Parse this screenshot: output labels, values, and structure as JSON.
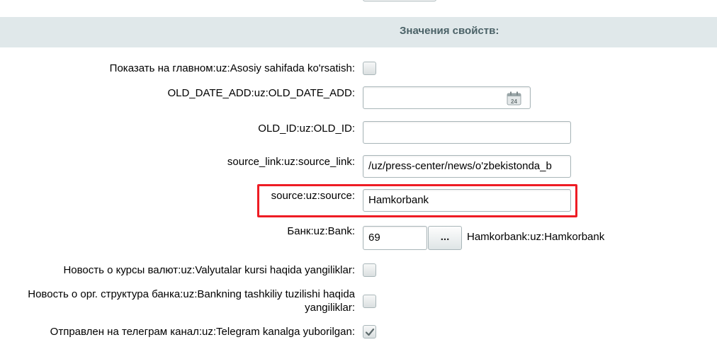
{
  "header": {
    "title": "Значения свойств:"
  },
  "fields": {
    "show_main": {
      "label": "Показать на главном:uz:Asosiy sahifada ko'rsatish:",
      "checked": false
    },
    "old_date_add": {
      "label": "OLD_DATE_ADD:uz:OLD_DATE_ADD:",
      "value": "",
      "icon": "calendar-icon",
      "calendar_day": "24"
    },
    "old_id": {
      "label": "OLD_ID:uz:OLD_ID:",
      "value": ""
    },
    "source_link": {
      "label": "source_link:uz:source_link:",
      "value": "/uz/press-center/news/o'zbekistonda_b"
    },
    "source": {
      "label": "source:uz:source:",
      "value": "Hamkorbank"
    },
    "bank": {
      "label": "Банк:uz:Bank:",
      "value": "69",
      "button_label": "...",
      "bank_name": "Hamkorbank:uz:Hamkorbank"
    },
    "currency_news": {
      "label": "Новость о курсы валют:uz:Valyutalar kursi haqida yangiliklar:",
      "checked": false
    },
    "org_structure_news": {
      "label": "Новость о орг. структура банка:uz:Bankning tashkiliy tuzilishi haqida yangiliklar:",
      "checked": false
    },
    "telegram_sent": {
      "label": "Отправлен на телеграм канал:uz:Telegram kanalga yuborilgan:",
      "checked": true
    }
  },
  "colors": {
    "highlight": "#ee1c24",
    "header_bg": "#e0e8ea",
    "header_text": "#4b6267",
    "border": "#a9b6b9"
  }
}
